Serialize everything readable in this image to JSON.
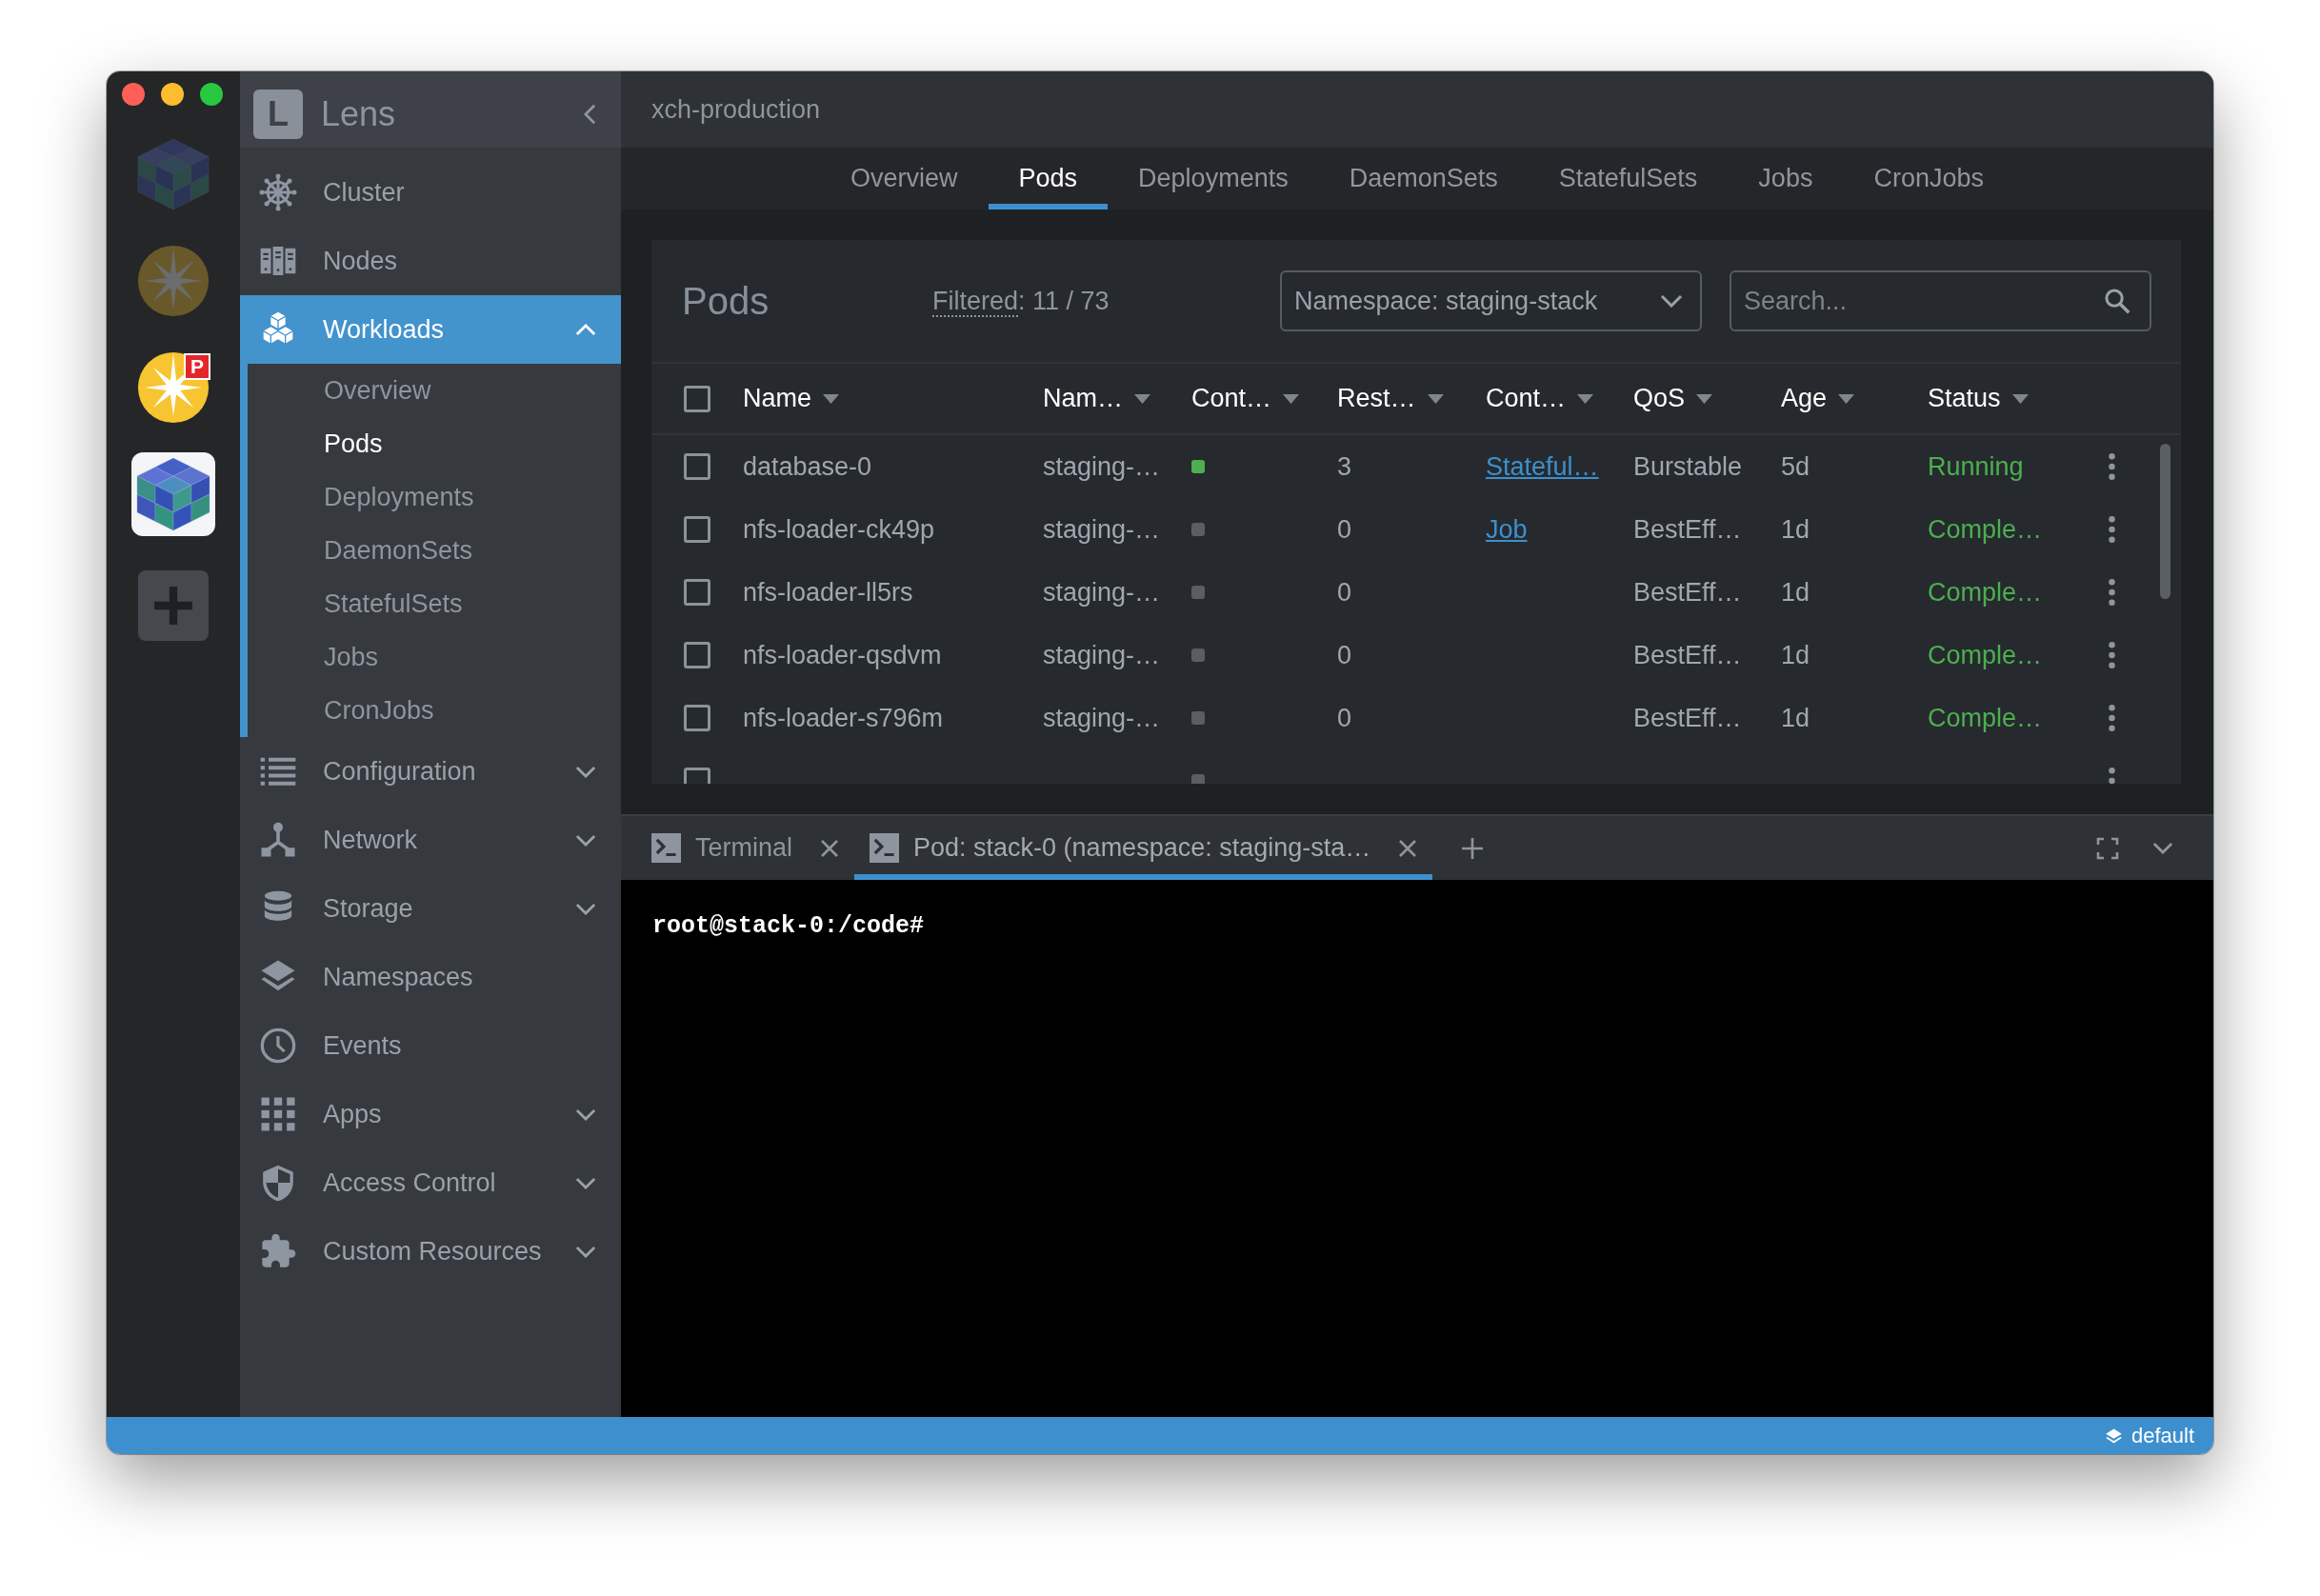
{
  "clusters": [
    {
      "kind": "cube",
      "connected": false,
      "selected": false
    },
    {
      "kind": "burst",
      "connected": false,
      "selected": false
    },
    {
      "kind": "burst",
      "connected": true,
      "selected": false,
      "badge": "P"
    },
    {
      "kind": "cube",
      "connected": true,
      "selected": true
    }
  ],
  "sidebar": {
    "logo": "L",
    "title": "Lens",
    "items": [
      {
        "kind": "link",
        "label": "Cluster",
        "selected": false
      },
      {
        "kind": "link",
        "label": "Nodes",
        "selected": false
      },
      {
        "kind": "group",
        "label": "Workloads",
        "selected": true,
        "expanded": true,
        "children": [
          {
            "label": "Overview",
            "selected": false
          },
          {
            "label": "Pods",
            "selected": true
          },
          {
            "label": "Deployments",
            "selected": false
          },
          {
            "label": "DaemonSets",
            "selected": false
          },
          {
            "label": "StatefulSets",
            "selected": false
          },
          {
            "label": "Jobs",
            "selected": false
          },
          {
            "label": "CronJobs",
            "selected": false
          }
        ]
      },
      {
        "kind": "group",
        "label": "Configuration",
        "selected": false,
        "expanded": false
      },
      {
        "kind": "group",
        "label": "Network",
        "selected": false,
        "expanded": false
      },
      {
        "kind": "group",
        "label": "Storage",
        "selected": false,
        "expanded": false
      },
      {
        "kind": "link",
        "label": "Namespaces",
        "selected": false
      },
      {
        "kind": "link",
        "label": "Events",
        "selected": false
      },
      {
        "kind": "group",
        "label": "Apps",
        "selected": false,
        "expanded": false
      },
      {
        "kind": "group",
        "label": "Access Control",
        "selected": false,
        "expanded": false
      },
      {
        "kind": "group",
        "label": "Custom Resources",
        "selected": false,
        "expanded": false
      }
    ]
  },
  "header": {
    "title": "xch-production"
  },
  "tabs": [
    {
      "label": "Overview",
      "selected": false
    },
    {
      "label": "Pods",
      "selected": true
    },
    {
      "label": "Deployments",
      "selected": false
    },
    {
      "label": "DaemonSets",
      "selected": false
    },
    {
      "label": "StatefulSets",
      "selected": false
    },
    {
      "label": "Jobs",
      "selected": false
    },
    {
      "label": "CronJobs",
      "selected": false
    }
  ],
  "pods": {
    "title": "Pods",
    "filter": {
      "label": "Filtered",
      "text": ": 11 / 73"
    },
    "namespace_select": {
      "value": "Namespace: staging-stack"
    },
    "search": {
      "placeholder": "Search..."
    },
    "table": {
      "select_all": {
        "checked": false
      },
      "columns": [
        "Name",
        "Nam…",
        "Cont…",
        "Rest…",
        "Cont…",
        "QoS",
        "Age",
        "Status"
      ],
      "rows": [
        {
          "checked": false,
          "name": "database-0",
          "namespace": "staging-…",
          "containers": [
            {
              "color": "#4caf50"
            }
          ],
          "restarts": "3",
          "controlled_by": "Stateful…",
          "qos": "Burstable",
          "age": "5d",
          "status": "Running"
        },
        {
          "checked": false,
          "name": "nfs-loader-ck49p",
          "namespace": "staging-…",
          "containers": [
            {
              "color": "#5a5e64"
            }
          ],
          "restarts": "0",
          "controlled_by": "Job",
          "qos": "BestEff…",
          "age": "1d",
          "status": "Comple…"
        },
        {
          "checked": false,
          "name": "nfs-loader-ll5rs",
          "namespace": "staging-…",
          "containers": [
            {
              "color": "#5a5e64"
            }
          ],
          "restarts": "0",
          "qos": "BestEff…",
          "age": "1d",
          "status": "Comple…"
        },
        {
          "checked": false,
          "name": "nfs-loader-qsdvm",
          "namespace": "staging-…",
          "containers": [
            {
              "color": "#5a5e64"
            }
          ],
          "restarts": "0",
          "qos": "BestEff…",
          "age": "1d",
          "status": "Comple…"
        },
        {
          "checked": false,
          "name": "nfs-loader-s796m",
          "namespace": "staging-…",
          "containers": [
            {
              "color": "#5a5e64"
            }
          ],
          "restarts": "0",
          "qos": "BestEff…",
          "age": "1d",
          "status": "Comple…"
        },
        {
          "checked": false,
          "containers": [
            {
              "color": "#5a5e64"
            }
          ]
        }
      ]
    }
  },
  "dock": {
    "tabs": [
      {
        "label": "Terminal",
        "selected": false
      },
      {
        "label": "Pod: stack-0 (namespace: staging-sta…",
        "selected": true
      }
    ],
    "terminal": {
      "lines": [
        "root@stack-0:/code#"
      ]
    }
  },
  "status_bar": {
    "namespace": "default"
  }
}
